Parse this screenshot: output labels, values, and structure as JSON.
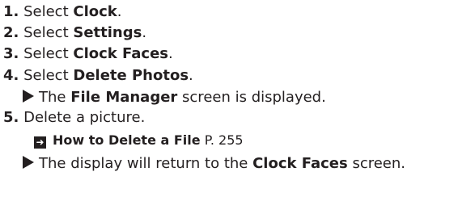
{
  "steps": [
    {
      "num": "1.",
      "prefix": "Select ",
      "bold": "Clock",
      "suffix": "."
    },
    {
      "num": "2.",
      "prefix": "Select ",
      "bold": "Settings",
      "suffix": "."
    },
    {
      "num": "3.",
      "prefix": "Select ",
      "bold": "Clock Faces",
      "suffix": "."
    },
    {
      "num": "4.",
      "prefix": "Select ",
      "bold": "Delete Photos",
      "suffix": "."
    },
    {
      "num": "5.",
      "text": "Delete a picture."
    }
  ],
  "result1": {
    "prefix": "The ",
    "bold": "File Manager",
    "suffix": " screen is displayed."
  },
  "reference": {
    "title": "How to Delete a File",
    "page": "P. 255"
  },
  "result2": {
    "prefix": "The display will return to the ",
    "bold": "Clock Faces",
    "suffix": " screen."
  },
  "icons": {
    "result_icon": "right-triangle-arrow",
    "reference_icon": "cross-reference-arrow"
  }
}
